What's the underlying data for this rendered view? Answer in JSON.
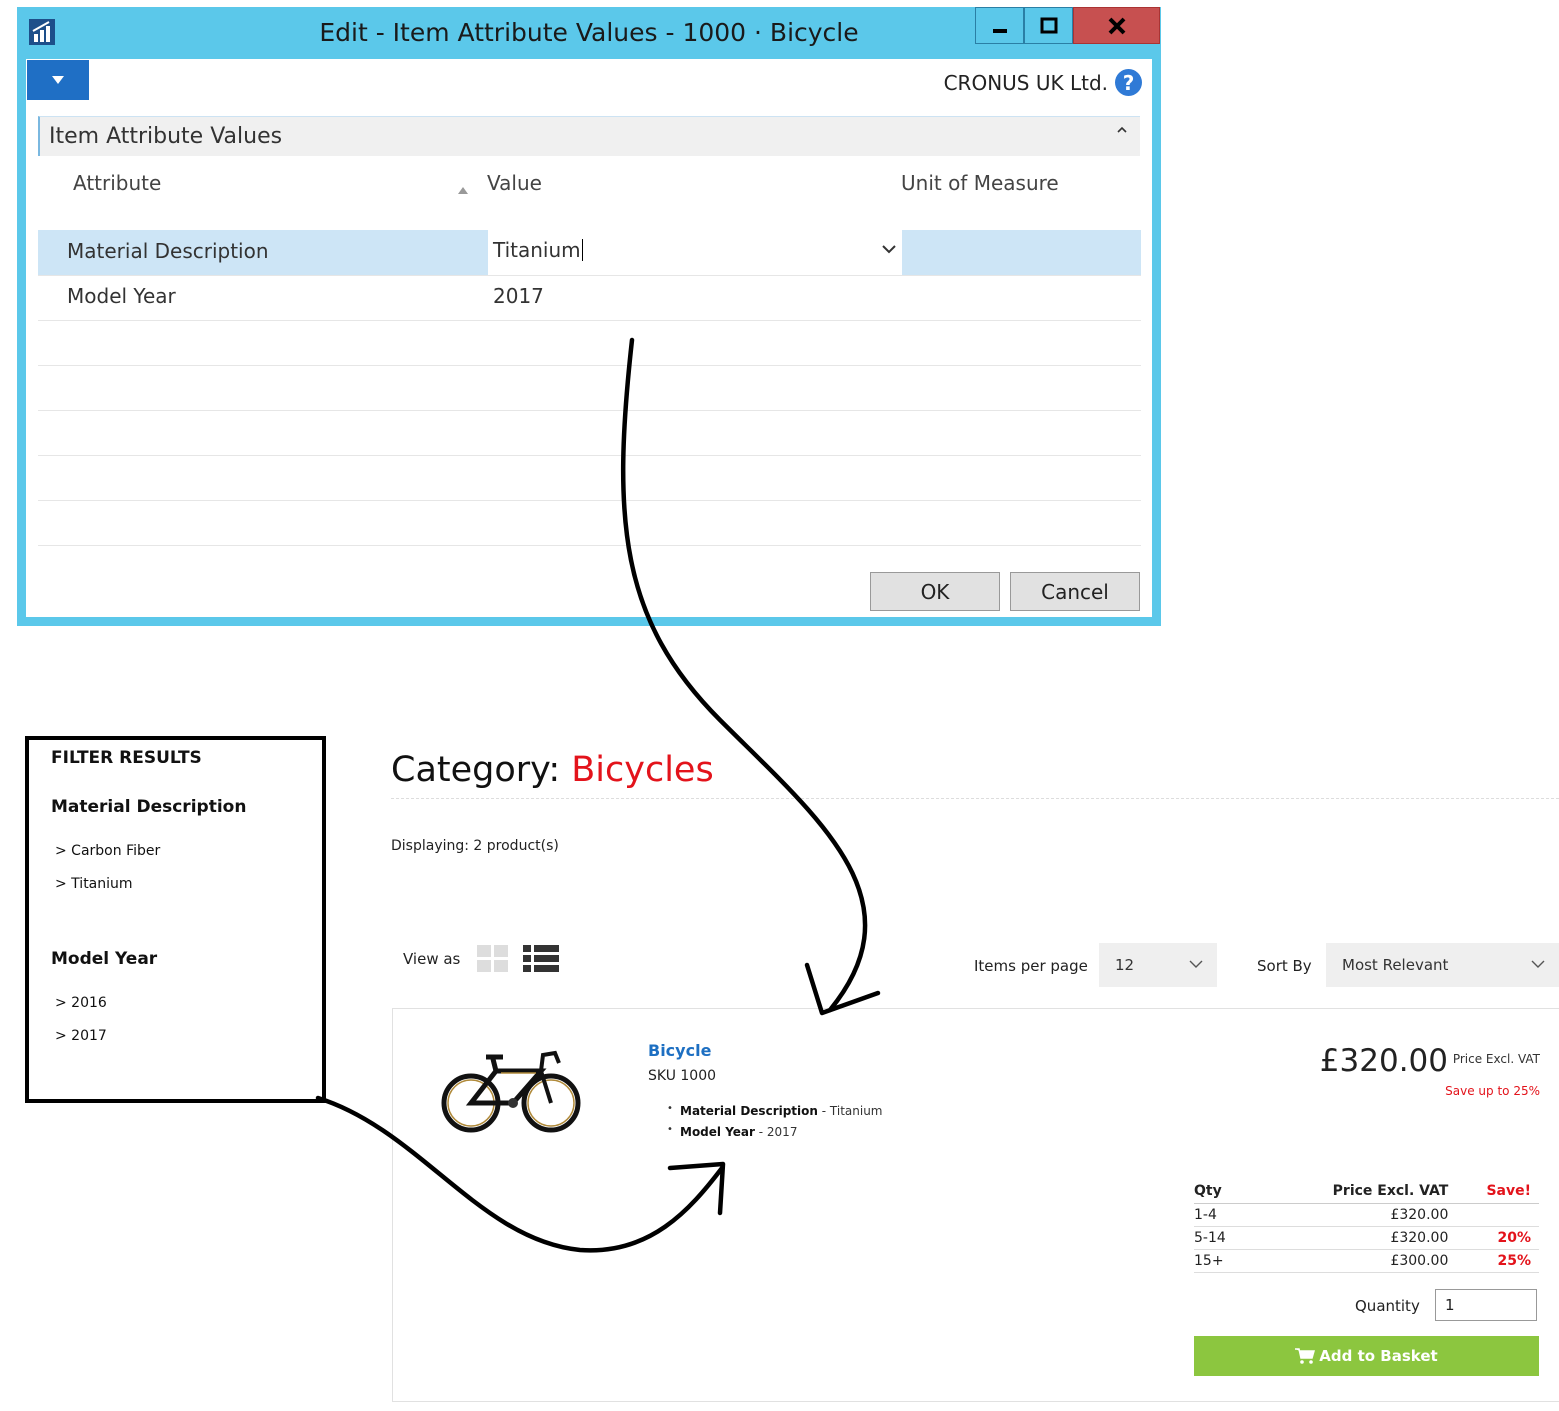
{
  "dialog": {
    "title": "Edit - Item Attribute Values - 1000 · Bicycle",
    "company": "CRONUS UK Ltd.",
    "help_glyph": "?",
    "section_title": "Item Attribute Values",
    "columns": {
      "attribute": "Attribute",
      "value": "Value",
      "unit": "Unit of Measure"
    },
    "rows": [
      {
        "attribute": "Material Description",
        "value": "Titanium",
        "unit": ""
      },
      {
        "attribute": "Model Year",
        "value": "2017",
        "unit": ""
      }
    ],
    "ok_label": "OK",
    "cancel_label": "Cancel",
    "colors": {
      "titlebar": "#5bc8ea",
      "close": "#c75050",
      "selected_row": "#cde5f6"
    },
    "icons": [
      "app-icon",
      "minimize-icon",
      "maximize-icon",
      "close-icon",
      "dropdown-arrow-icon",
      "help-icon",
      "collapse-icon",
      "sort-ascending-icon",
      "chevron-down-icon"
    ]
  },
  "filter": {
    "title": "FILTER RESULTS",
    "groups": [
      {
        "name": "Material Description",
        "items": [
          "> Carbon Fiber",
          "> Titanium"
        ]
      },
      {
        "name": "Model Year",
        "items": [
          "> 2016",
          "> 2017"
        ]
      }
    ]
  },
  "shop": {
    "category_label": "Category:",
    "category_value": "Bicycles",
    "displaying": "Displaying: 2 product(s)",
    "view_as": "View as",
    "items_per_page_label": "Items per page",
    "items_per_page_value": "12",
    "sort_by_label": "Sort By",
    "sort_by_value": "Most Relevant",
    "colors": {
      "accent": "#e3131b",
      "link": "#1d6fc2",
      "basket": "#8cc63f"
    },
    "product": {
      "name": "Bicycle",
      "sku": "SKU 1000",
      "attributes": [
        {
          "name": "Material Description",
          "value": " - Titanium"
        },
        {
          "name": "Model Year",
          "value": " - 2017"
        }
      ],
      "price": "£320.00",
      "price_note": "Price Excl. VAT",
      "save_note": "Save up to 25%",
      "tier_headers": {
        "qty": "Qty",
        "price": "Price Excl. VAT",
        "save": "Save!"
      },
      "tiers": [
        {
          "qty": "1-4",
          "price": "£320.00",
          "save": ""
        },
        {
          "qty": "5-14",
          "price": "£320.00",
          "save": "20%"
        },
        {
          "qty": "15+",
          "price": "£300.00",
          "save": "25%"
        }
      ],
      "quantity_label": "Quantity",
      "quantity_value": "1",
      "add_label": "Add to Basket"
    }
  }
}
